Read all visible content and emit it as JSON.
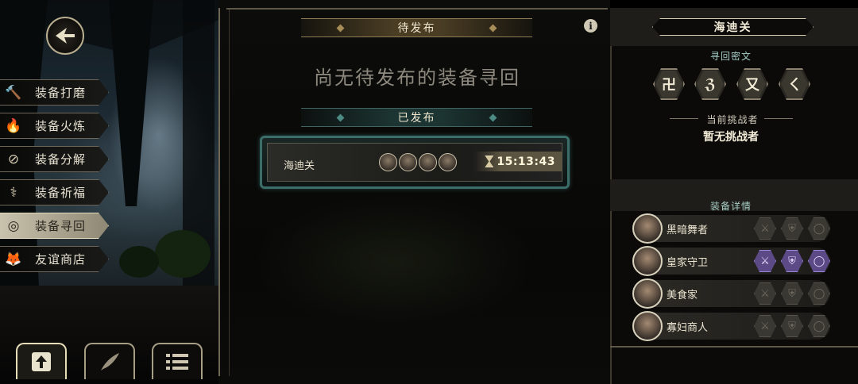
{
  "nav": {
    "items": [
      {
        "label": "装备打磨",
        "icon": "hammer-icon",
        "glyph": "🔨",
        "active": false
      },
      {
        "label": "装备火炼",
        "icon": "flame-icon",
        "glyph": "🔥",
        "active": false
      },
      {
        "label": "装备分解",
        "icon": "disassemble-icon",
        "glyph": "⊘",
        "active": false
      },
      {
        "label": "装备祈福",
        "icon": "pray-icon",
        "glyph": "⚕",
        "active": false
      },
      {
        "label": "装备寻回",
        "icon": "target-icon",
        "glyph": "◎",
        "active": true
      },
      {
        "label": "友谊商店",
        "icon": "fox-icon",
        "glyph": "🦊",
        "active": false
      }
    ],
    "bottom_buttons": [
      {
        "icon": "upload-icon",
        "active": true
      },
      {
        "icon": "feather-icon",
        "active": false
      },
      {
        "icon": "list-icon",
        "active": false
      }
    ]
  },
  "center": {
    "pending_title": "待发布",
    "pending_empty": "尚无待发布的装备寻回",
    "published_title": "已发布",
    "info_glyph": "i",
    "quest": {
      "name": "海迪关",
      "timer": "15:13:43",
      "hero_count": 4
    }
  },
  "right": {
    "title": "海迪关",
    "cipher_heading": "寻回密文",
    "glyphs": [
      "卍",
      "ℨ",
      "又",
      "ㄑ"
    ],
    "challenger_heading": "当前挑战者",
    "challenger_value": "暂无挑战者",
    "equip_heading": "装备详情",
    "heroes": [
      {
        "name": "黑暗舞者",
        "slots": [
          "weapon",
          "armor",
          "ring"
        ],
        "highlighted": false
      },
      {
        "name": "皇家守卫",
        "slots": [
          "weapon",
          "armor",
          "ring"
        ],
        "highlighted": true
      },
      {
        "name": "美食家",
        "slots": [
          "weapon",
          "armor",
          "ring"
        ],
        "highlighted": false
      },
      {
        "name": "寡妇商人",
        "slots": [
          "weapon",
          "armor",
          "ring"
        ],
        "highlighted": false
      }
    ]
  },
  "colors": {
    "teal_accent": "#3c6e69",
    "gold_accent": "#a68c56",
    "highlight_purple": "#5b4a86"
  }
}
